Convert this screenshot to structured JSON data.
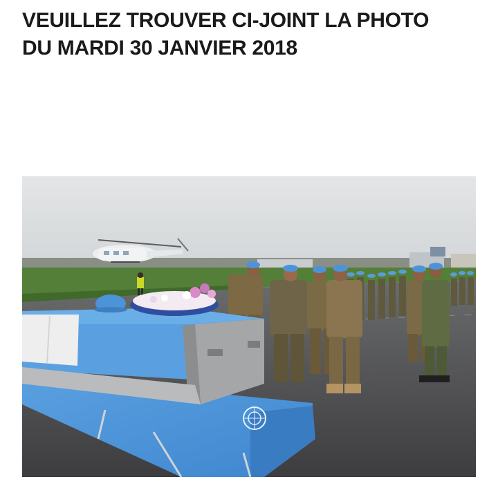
{
  "post": {
    "headline_line1": "VEUILLEZ TROUVER CI-JOINT LA PHOTO",
    "headline_line2": "DU MARDI 30 JANVIER 2018"
  },
  "photo": {
    "subject": "un-memorial-ceremony",
    "colors": {
      "sky": "#dde0e2",
      "grass": "#4f7a35",
      "tarmac": "#4a4a4c",
      "un_blue": "#4b90d6",
      "uniform": "#7d6a45",
      "helicopter": "#e9ecef"
    }
  }
}
